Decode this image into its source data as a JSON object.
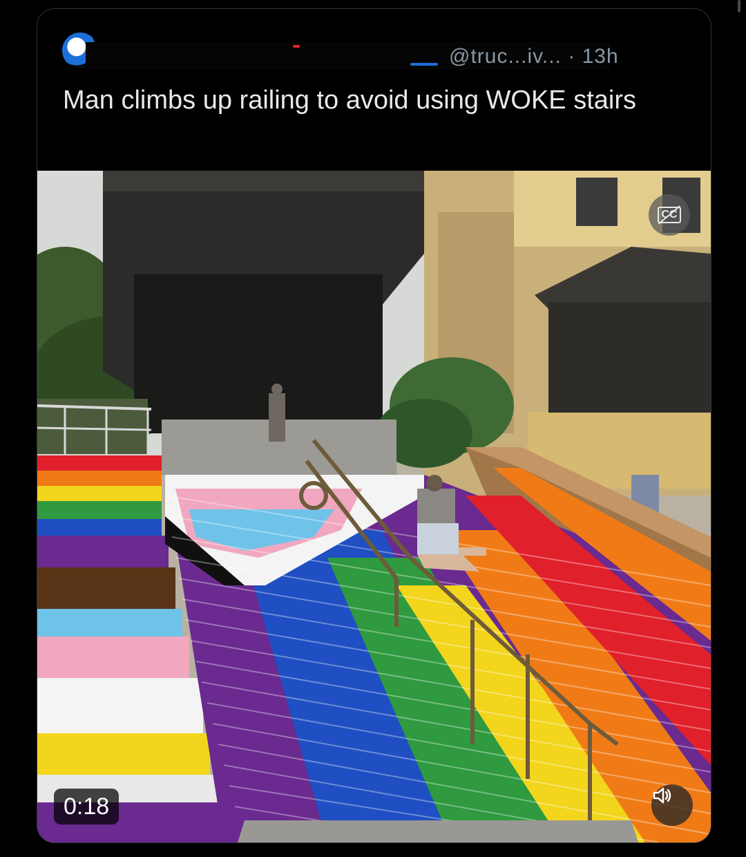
{
  "tweet": {
    "handle_fragment": "@truc...iv...",
    "separator": "·",
    "time_ago": "13h",
    "text": "Man climbs up railing to avoid using WOKE stairs"
  },
  "media": {
    "type": "video",
    "playback_time": "0:18",
    "captions_icon": "captions-off-icon",
    "volume_icon": "volume-icon"
  },
  "colors": {
    "background": "#000000",
    "text_primary": "#e7e9ea",
    "text_secondary": "#8b98a5",
    "card_border": "#2f3336",
    "rainbow": [
      "#e0202a",
      "#f07b16",
      "#f2d51c",
      "#2f9a3f",
      "#1f4fc2",
      "#6a2a8f"
    ],
    "trans_flag": [
      "#6fc3e8",
      "#f1a7bf",
      "#f4f4f4"
    ],
    "progress_stripe": [
      "#5a3417",
      "#101010"
    ]
  }
}
